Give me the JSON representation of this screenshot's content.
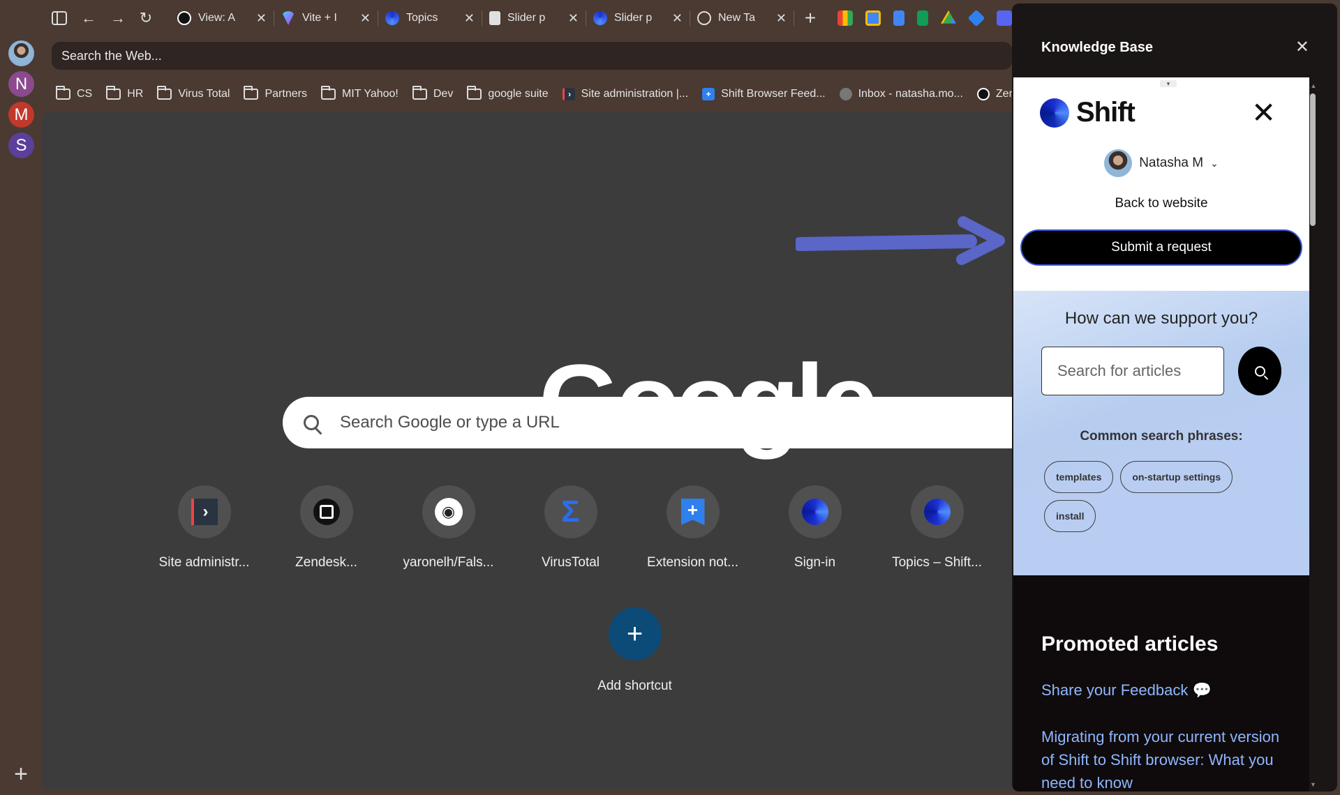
{
  "rail": {
    "workspaces": [
      {
        "letter": "",
        "color": "#7aa0c8"
      },
      {
        "letter": "N",
        "color": "#8b4a8e"
      },
      {
        "letter": "M",
        "color": "#c0392b"
      },
      {
        "letter": "S",
        "color": "#5b3f9a"
      }
    ],
    "add": "+"
  },
  "tabs": [
    {
      "title": "View: A",
      "fav_color": "#111"
    },
    {
      "title": "Vite + I",
      "fav_color": "#9b5cf6"
    },
    {
      "title": "Topics",
      "fav_color": "#1b2fd1"
    },
    {
      "title": "Slider p",
      "fav_color": "#e0e0e0"
    },
    {
      "title": "Slider p",
      "fav_color": "#1b2fd1"
    },
    {
      "title": "New Ta",
      "fav_color": "#555"
    }
  ],
  "address": {
    "placeholder": "Search the Web..."
  },
  "bookmarks": [
    {
      "label": "CS",
      "type": "folder"
    },
    {
      "label": "HR",
      "type": "folder"
    },
    {
      "label": "Virus Total",
      "type": "folder"
    },
    {
      "label": "Partners",
      "type": "folder"
    },
    {
      "label": "MIT Yahoo!",
      "type": "folder"
    },
    {
      "label": "Dev",
      "type": "folder"
    },
    {
      "label": "google suite",
      "type": "folder"
    },
    {
      "label": "Site administration |...",
      "type": "site"
    },
    {
      "label": "Shift Browser Feed...",
      "type": "ext"
    },
    {
      "label": "Inbox - natasha.mo...",
      "type": "inbox"
    },
    {
      "label": "Zen",
      "type": "zen"
    }
  ],
  "google": {
    "logo": "Google",
    "search_placeholder": "Search Google or type a URL",
    "shortcuts": [
      {
        "label": "Site administr...",
        "icon": "site-admin-icon"
      },
      {
        "label": "Zendesk...",
        "icon": "zendesk-icon"
      },
      {
        "label": "yaronelh/Fals...",
        "icon": "github-icon"
      },
      {
        "label": "VirusTotal",
        "icon": "virustotal-icon"
      },
      {
        "label": "Extension not...",
        "icon": "extension-icon"
      },
      {
        "label": "Sign-in",
        "icon": "shift-icon"
      },
      {
        "label": "Topics – Shift...",
        "icon": "shift-icon"
      }
    ],
    "add_shortcut": "Add shortcut"
  },
  "panel": {
    "title": "Knowledge Base",
    "kb": {
      "brand": "Shift",
      "user": "Natasha M",
      "back": "Back to website",
      "submit": "Submit a request",
      "question": "How can we support you?",
      "search_placeholder": "Search for articles",
      "common_caption": "Common search phrases:",
      "chips": [
        "templates",
        "on-startup settings",
        "install"
      ],
      "promoted_title": "Promoted articles",
      "articles": [
        "Share your Feedback 💬",
        "Migrating from your current version of Shift to Shift browser: What you need to know"
      ]
    }
  },
  "colors": {
    "accent_arrow": "#5a66c8",
    "link": "#8fb6ff"
  }
}
